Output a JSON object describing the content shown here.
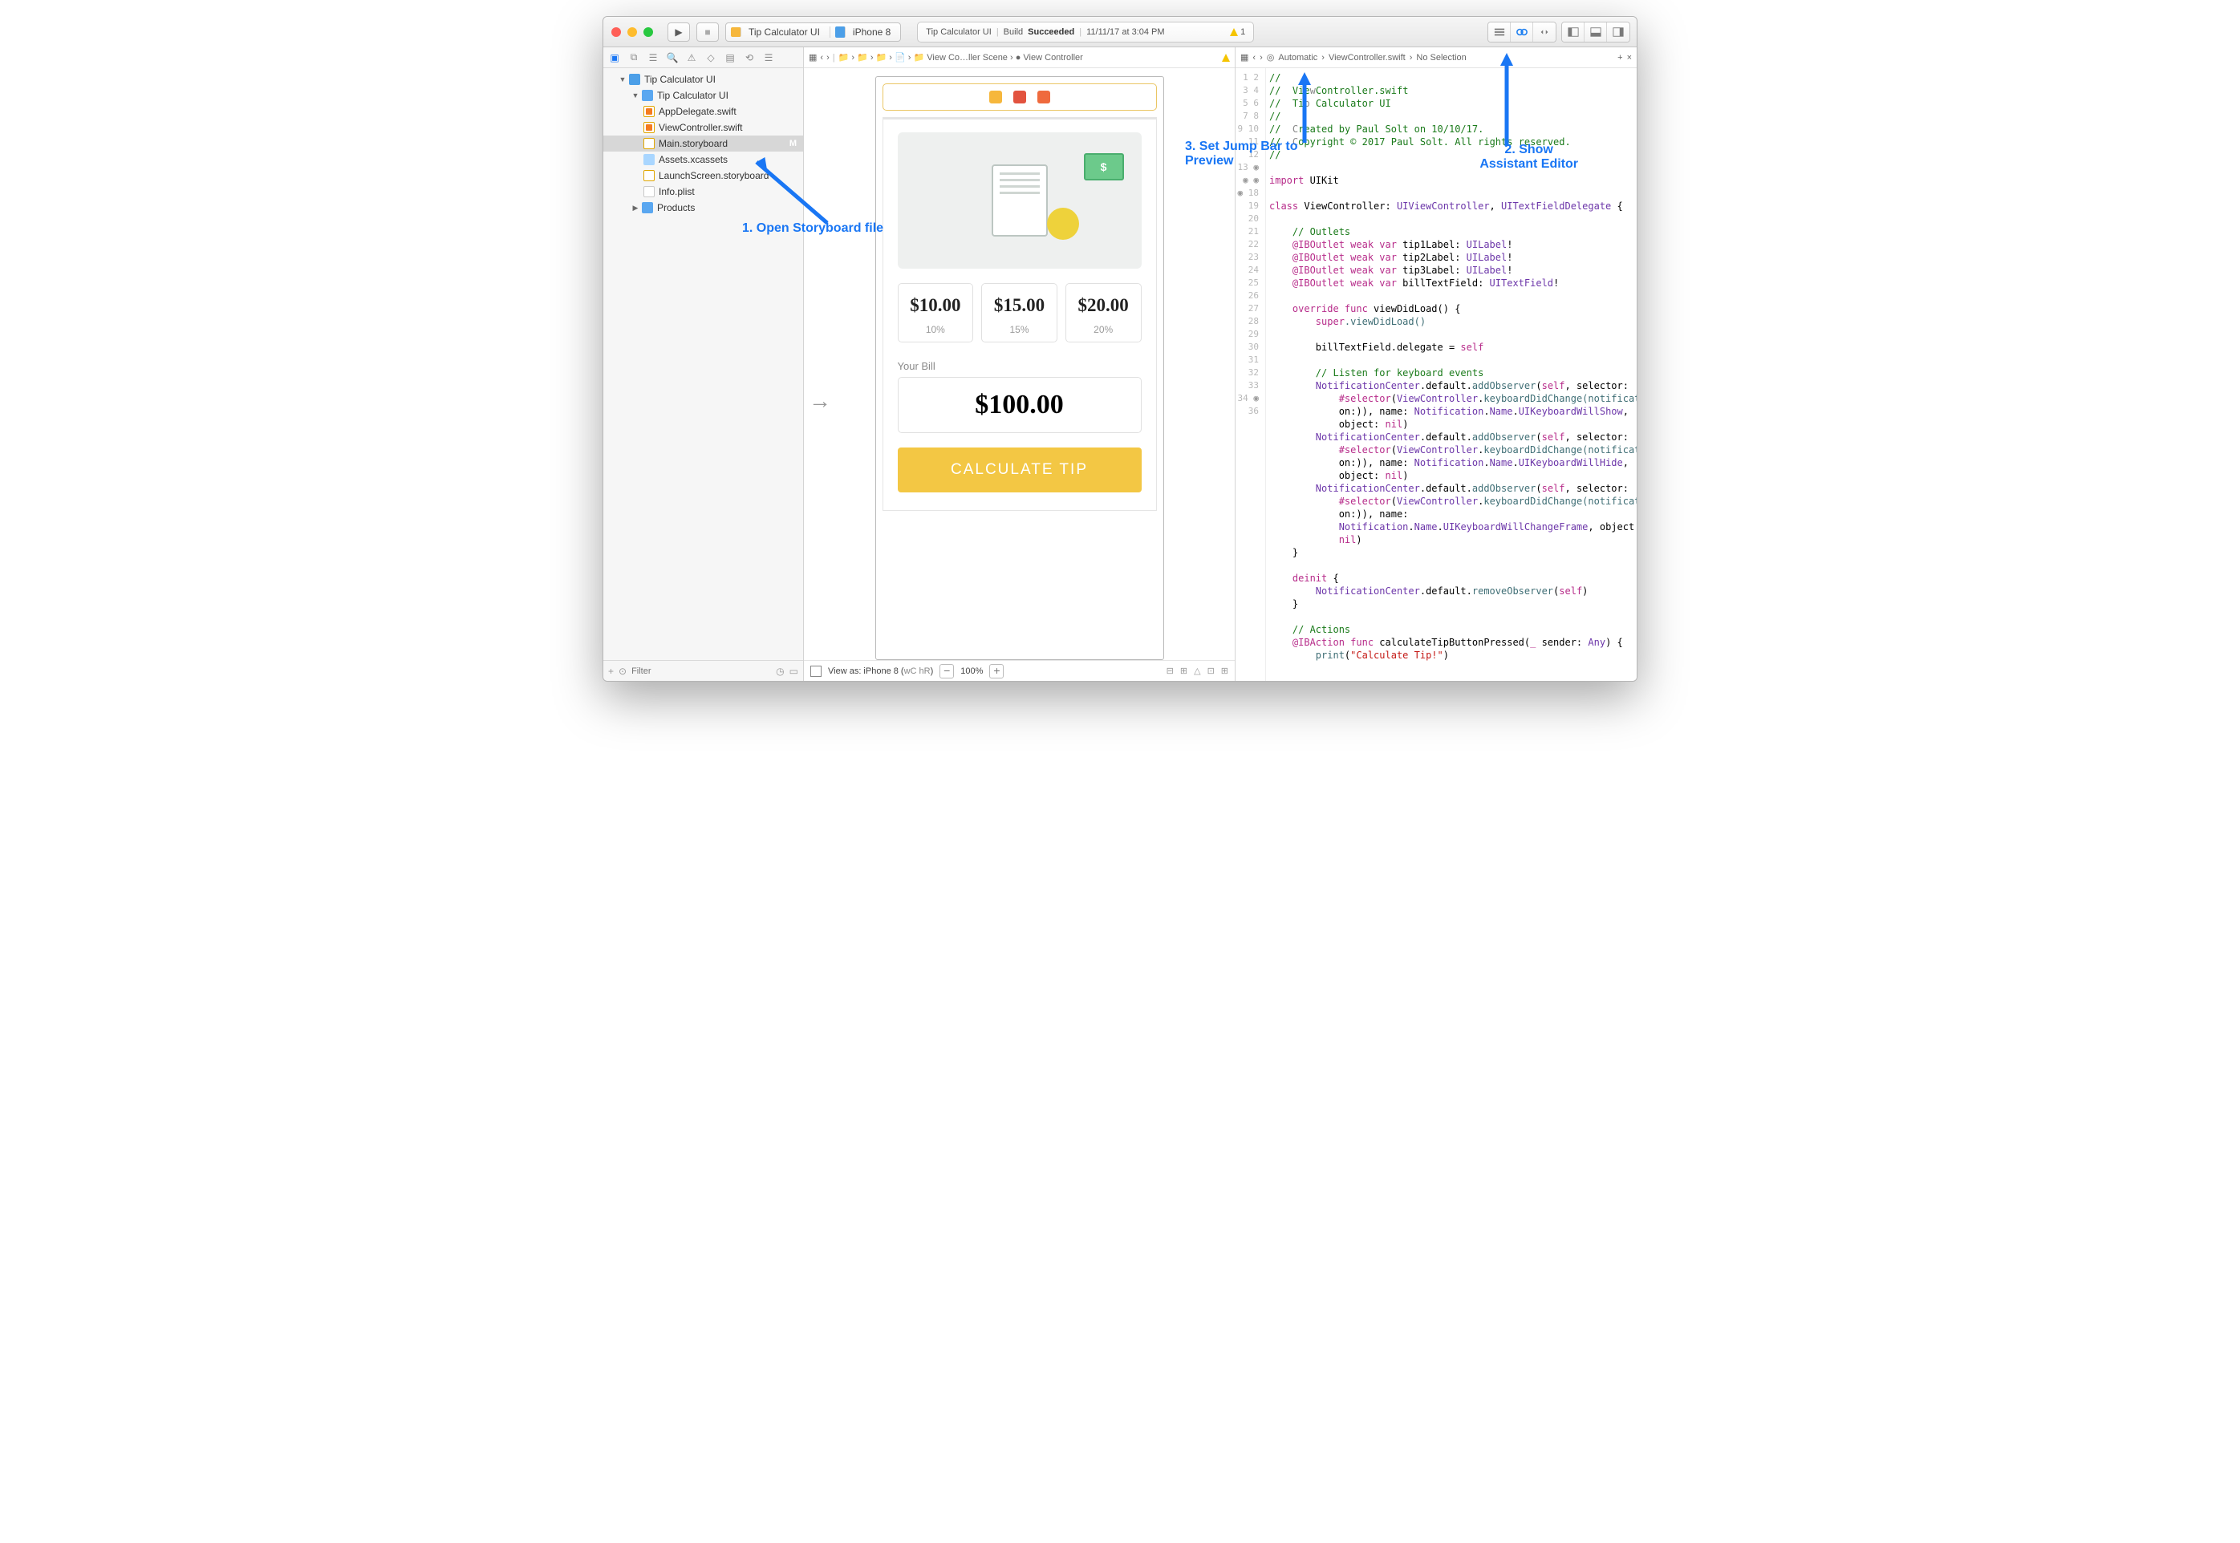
{
  "toolbar": {
    "scheme_left": "Tip Calculator UI",
    "scheme_right": "iPhone 8",
    "status_app": "Tip Calculator UI",
    "status_build": "Build",
    "status_result": "Succeeded",
    "status_time": "11/11/17 at 3:04 PM",
    "warning_count": "1"
  },
  "navigator": {
    "root": "Tip Calculator UI",
    "group": "Tip Calculator UI",
    "files": {
      "appdelegate": "AppDelegate.swift",
      "viewcontroller": "ViewController.swift",
      "storyboard": "Main.storyboard",
      "assets": "Assets.xcassets",
      "launchscreen": "LaunchScreen.storyboard",
      "infoplist": "Info.plist"
    },
    "products": "Products",
    "modified_tag": "M",
    "filter_placeholder": "Filter",
    "add_label": "+"
  },
  "ib_jumpbar": {
    "scene": "View Co…ller Scene",
    "controller": "View Controller"
  },
  "canvas": {
    "tip1": "$10.00",
    "tip1pct": "10%",
    "tip2": "$15.00",
    "tip2pct": "15%",
    "tip3": "$20.00",
    "tip3pct": "20%",
    "bill_label": "Your Bill",
    "bill_value": "$100.00",
    "button": "CALCULATE TIP"
  },
  "ib_bottom": {
    "viewas": "View as: iPhone 8 (",
    "size": "wC hR",
    "close": ")",
    "zoom": "100%"
  },
  "assist_jump": {
    "mode": "Automatic",
    "file": "ViewController.swift",
    "sel": "No Selection"
  },
  "annotations": {
    "a1": "1. Open Storyboard file",
    "a2": "2. Show\nAssistant Editor",
    "a3": "3. Set Jump Bar to\nPreview"
  },
  "code": {
    "l1": "//",
    "l2f": "//  ",
    "l2b": "Vie",
    "l2c": "Controller.swift",
    "l3f": "//  ",
    "l3b": "Ti",
    "l3c": " Calculator UI",
    "l4": "//",
    "l5a": "//  ",
    "l5b": "reated by ",
    "l5c": "Paul Solt on 10/10/17.",
    "l6a": "//  ",
    "l6b": "opyright © ",
    "l6c": "2017 Paul Solt. All rights reserved.",
    "l7": "//",
    "l9a": "import",
    "l9b": " UIKit",
    "l11a": "class ",
    "l11b": "ViewController: ",
    "l11c": "UIViewController",
    "l11d": ", ",
    "l11e": "UITextFieldDelegate",
    "l11f": " {",
    "l13": "    // Outlets",
    "l14a": "    @IBOutlet",
    "l14b": " weak var",
    "l14c": " tip1Label: ",
    "l14d": "UILabel",
    "l14e": "!",
    "l15c": " tip2Label: ",
    "l16c": " tip3Label: ",
    "l17c": " billTextField: ",
    "l17d": "UITextField",
    "l19a": "    override func",
    "l19b": " viewDidLoad() {",
    "l20a": "        super",
    "l20b": ".viewDidLoad()",
    "l22": "        billTextField.delegate = ",
    "l22b": "self",
    "l24": "        // Listen for keyboard events",
    "l25a": "        NotificationCenter",
    "l25b": ".default.",
    "l25c": "addObserver",
    "l25d": "(",
    "l25e": "self",
    "l25f": ", selector:",
    "l25g": "            #selector",
    "l25h": "(",
    "l25i": "ViewController",
    "l25j": ".",
    "l25k": "keyboardDidChange(notification:",
    "l25l": "",
    "l25m": "            on:)), name: ",
    "l25n": "Notification",
    "l25o": ".",
    "l25p": "Name",
    "l25q": ".",
    "l25r": "UIKeyboardWillShow",
    "l25s": ",",
    "l25t": "            object: ",
    "l25u": "nil",
    "l25v": ")",
    "l26r": "UIKeyboardWillHide",
    "l27m": "            on:)), name:",
    "l27n": "            Notification",
    "l27r": "UIKeyboardWillChangeFrame",
    "l27s": ", object:",
    "l27u": "            nil",
    "l27v": ")",
    "l28": "    }",
    "l30": "    deinit ",
    "l30b": "{",
    "l31a": "        NotificationCenter",
    "l31b": ".default.",
    "l31c": "removeObserver",
    "l31d": "(",
    "l31e": "self",
    "l31f": ")",
    "l32": "    }",
    "l34": "    // Actions",
    "l35a": "    @IBAction",
    "l35b": " func",
    "l35c": " calculateTipButtonPressed(",
    "l35d": "_",
    "l35e": " sender: ",
    "l35f": "Any",
    "l35g": ") {",
    "l36a": "        print",
    "l36b": "(",
    "l36c": "\"Calculate Tip!\"",
    "l36d": ")"
  }
}
